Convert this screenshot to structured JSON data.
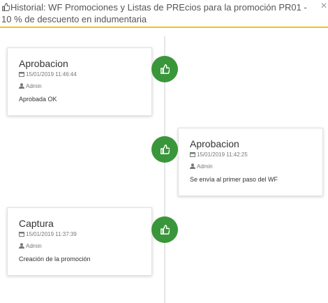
{
  "header": {
    "title": "Historial: WF Promociones y Listas de PREcios para la promoción PR01 - 10 % de descuento en indumentaria",
    "close_label": "×"
  },
  "colors": {
    "accent_border": "#f0c419",
    "badge": "#3a963a"
  },
  "timeline": [
    {
      "title": "Aprobacion",
      "datetime": "15/01/2019 11:46:44",
      "user": "Admin",
      "description": "Aprobada OK",
      "side": "left",
      "icon": "thumbs-up-icon"
    },
    {
      "title": "Aprobacion",
      "datetime": "15/01/2019 11:42:25",
      "user": "Admin",
      "description": "Se envía al primer paso del WF",
      "side": "right",
      "icon": "thumbs-up-icon"
    },
    {
      "title": "Captura",
      "datetime": "15/01/2019 11:37:39",
      "user": "Admin",
      "description": "Creación de la promoción",
      "side": "left",
      "icon": "thumbs-up-icon"
    }
  ]
}
